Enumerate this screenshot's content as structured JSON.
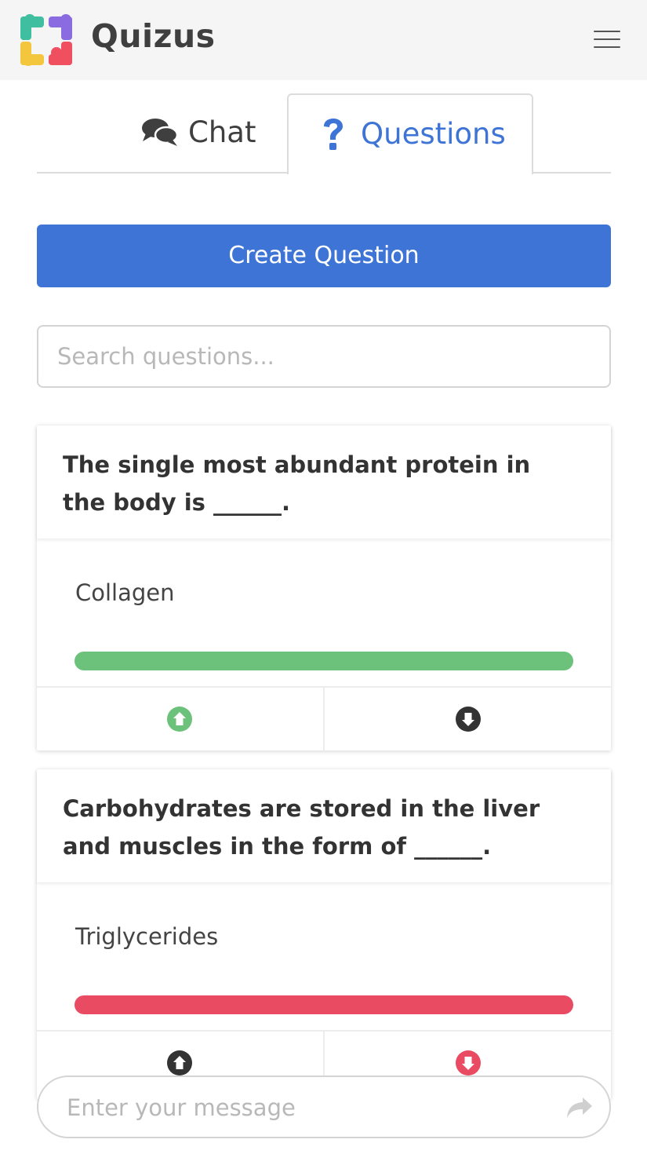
{
  "header": {
    "title": "Quizus",
    "menu_icon": "hamburger-menu-icon"
  },
  "tabs": [
    {
      "label": "Chat",
      "icon": "comments-icon",
      "active": false
    },
    {
      "label": "Questions",
      "icon": "question-icon",
      "active": true
    }
  ],
  "create_button": {
    "label": "Create Question"
  },
  "search": {
    "placeholder": "Search questions...",
    "value": ""
  },
  "questions": [
    {
      "question": "The single most abundant protein in the body is ______.",
      "answer": "Collagen",
      "result_color": "#6cc27a",
      "upvote_color": "#6cc27a",
      "downvote_color": "#333333"
    },
    {
      "question": "Carbohydrates are stored in the liver and muscles in the form of ______.",
      "answer": "Triglycerides",
      "result_color": "#e94b63",
      "upvote_color": "#333333",
      "downvote_color": "#e94b63"
    }
  ],
  "message": {
    "placeholder": "Enter your message",
    "value": "",
    "send_icon": "share-arrow-icon"
  },
  "colors": {
    "accent": "#3d74d5",
    "header_bg": "#f5f5f5"
  }
}
